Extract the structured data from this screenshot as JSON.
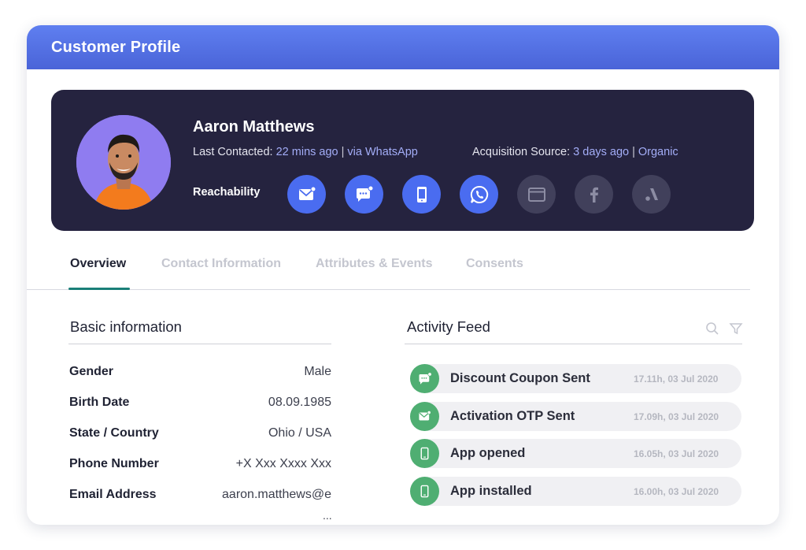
{
  "header": {
    "title": "Customer Profile"
  },
  "profile": {
    "name": "Aaron Matthews",
    "last_contacted_label": "Last Contacted:",
    "last_contacted_time": "22 mins ago",
    "last_contacted_via": "via WhatsApp",
    "acquisition_label": "Acquisition Source:",
    "acquisition_time": "3 days ago",
    "acquisition_source": "Organic",
    "reachability_label": "Reachability",
    "separator": "|"
  },
  "channels": [
    {
      "icon": "email-icon",
      "active": true
    },
    {
      "icon": "sms-icon",
      "active": true
    },
    {
      "icon": "mobile-push-icon",
      "active": true
    },
    {
      "icon": "whatsapp-icon",
      "active": true
    },
    {
      "icon": "web-push-icon",
      "active": false
    },
    {
      "icon": "facebook-icon",
      "active": false
    },
    {
      "icon": "ads-icon",
      "active": false
    }
  ],
  "tabs": [
    {
      "label": "Overview",
      "active": true
    },
    {
      "label": "Contact Information",
      "active": false
    },
    {
      "label": "Attributes & Events",
      "active": false
    },
    {
      "label": "Consents",
      "active": false
    }
  ],
  "basic_info": {
    "title": "Basic information",
    "rows": [
      {
        "label": "Gender",
        "value": "Male"
      },
      {
        "label": "Birth Date",
        "value": "08.09.1985"
      },
      {
        "label": "State / Country",
        "value": "Ohio / USA"
      },
      {
        "label": "Phone Number",
        "value": "+X Xxx Xxxx Xxx"
      },
      {
        "label": "Email Address",
        "value": "aaron.matthews@e"
      }
    ],
    "more": "..."
  },
  "activity_feed": {
    "title": "Activity Feed",
    "items": [
      {
        "text": "Discount Coupon Sent",
        "time": "17.11h, 03 Jul 2020",
        "icon": "sms-icon"
      },
      {
        "text": "Activation OTP Sent",
        "time": "17.09h, 03 Jul 2020",
        "icon": "email-icon"
      },
      {
        "text": "App opened",
        "time": "16.05h, 03 Jul 2020",
        "icon": "mobile-icon"
      },
      {
        "text": "App installed",
        "time": "16.00h, 03 Jul 2020",
        "icon": "mobile-icon"
      }
    ]
  },
  "colors": {
    "header": "#4a64d8",
    "profile_bg": "#25233f",
    "channel_active": "#4a6cf0",
    "channel_inactive": "#41405b",
    "feed_icon": "#4fae72",
    "tab_underline": "#1a7f78",
    "highlight": "#a3adf7"
  }
}
